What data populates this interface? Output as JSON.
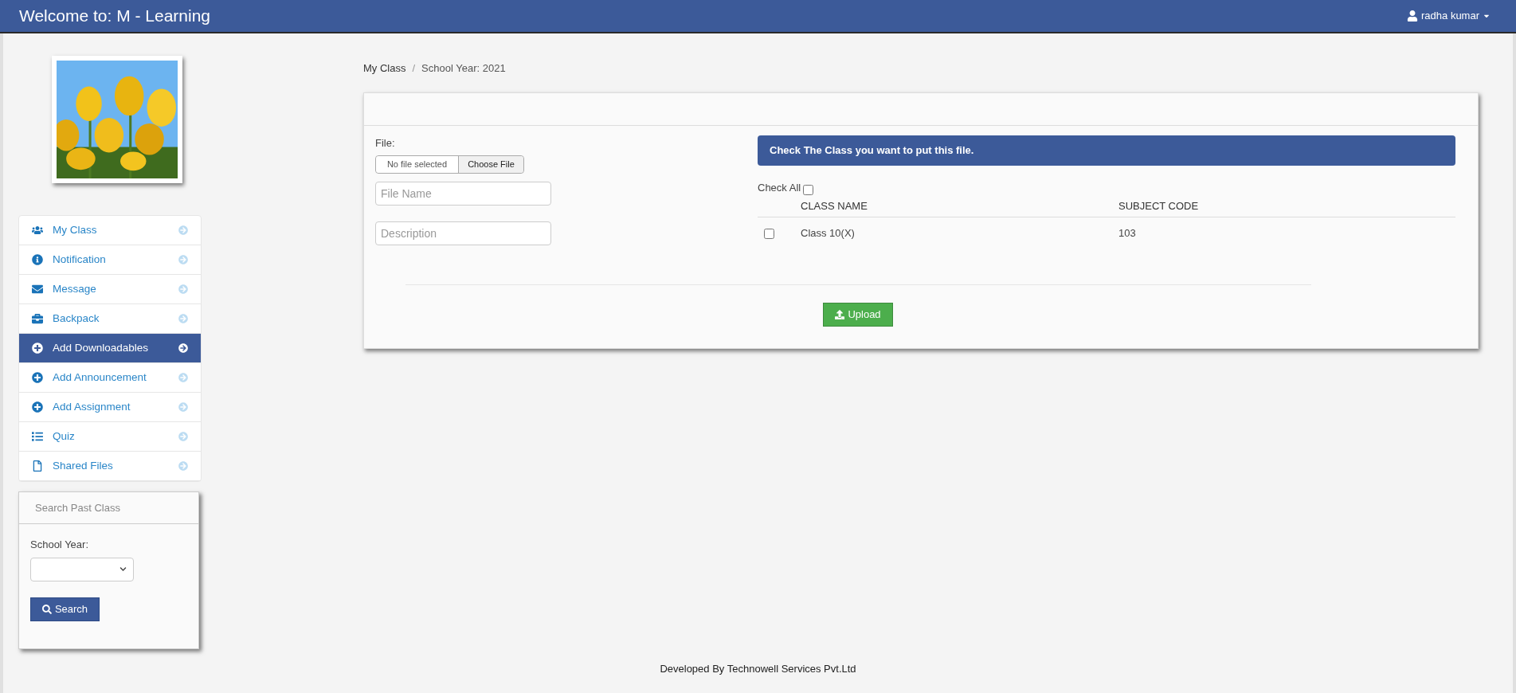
{
  "header": {
    "title": "Welcome to: M - Learning",
    "user": "radha kumar"
  },
  "sidebar": {
    "items": [
      {
        "label": "My Class",
        "selected": false
      },
      {
        "label": "Notification",
        "selected": false
      },
      {
        "label": "Message",
        "selected": false
      },
      {
        "label": "Backpack",
        "selected": false
      },
      {
        "label": "Add Downloadables",
        "selected": true
      },
      {
        "label": "Add Announcement",
        "selected": false
      },
      {
        "label": "Add Assignment",
        "selected": false
      },
      {
        "label": "Quiz",
        "selected": false
      },
      {
        "label": "Shared Files",
        "selected": false
      }
    ],
    "search_panel": {
      "title": "Search Past Class",
      "year_label": "School Year:",
      "button": "Search"
    }
  },
  "breadcrumb": {
    "separator": "/",
    "items": [
      "My Class",
      "School Year: 2021"
    ]
  },
  "form": {
    "file_label": "File:",
    "file_status": "No file selected",
    "choose_button": "Choose File",
    "file_name": {
      "placeholder": "File Name"
    },
    "description": {
      "placeholder": "Description"
    },
    "notice": "Check The Class you want to put this file.",
    "check_all": {
      "label": "Check All",
      "checked": false
    },
    "table": {
      "columns": [
        "CLASS NAME",
        "SUBJECT CODE"
      ],
      "rows": [
        {
          "checked": false,
          "cells": [
            "Class 10(X)",
            "103"
          ]
        }
      ]
    },
    "upload_button": "Upload"
  },
  "footer": "Developed By Technowell Services Pvt.Ltd"
}
